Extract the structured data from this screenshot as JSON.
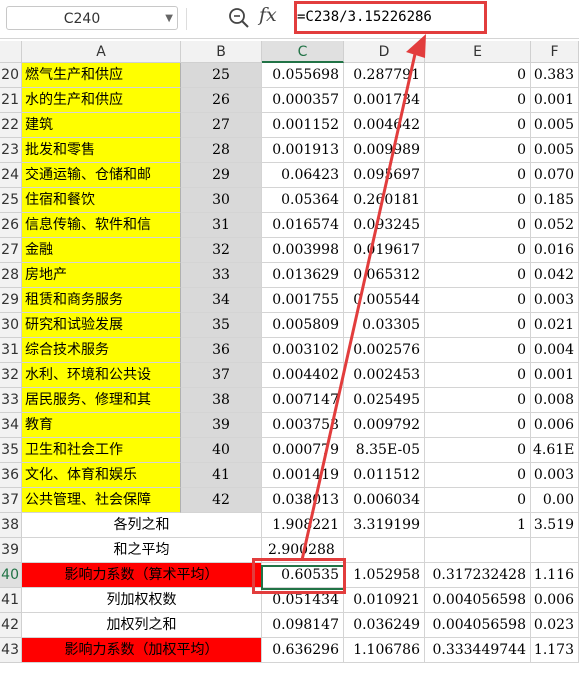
{
  "formula_bar": {
    "name_box": "C240",
    "fx_label": "fx",
    "formula": "=C238/3.15226286"
  },
  "columns": [
    "A",
    "B",
    "C",
    "D",
    "E",
    "F"
  ],
  "rows": [
    {
      "num": "20",
      "a": "燃气生产和供应",
      "b": "25",
      "c": "0.055698",
      "d": "0.287791",
      "e": "0",
      "f": "0.383"
    },
    {
      "num": "21",
      "a": "水的生产和供应",
      "b": "26",
      "c": "0.000357",
      "d": "0.001734",
      "e": "0",
      "f": "0.001"
    },
    {
      "num": "22",
      "a": "建筑",
      "b": "27",
      "c": "0.001152",
      "d": "0.004642",
      "e": "0",
      "f": "0.005"
    },
    {
      "num": "23",
      "a": "批发和零售",
      "b": "28",
      "c": "0.001913",
      "d": "0.009989",
      "e": "0",
      "f": "0.005"
    },
    {
      "num": "24",
      "a": "交通运输、仓储和邮",
      "b": "29",
      "c": "0.06423",
      "d": "0.095697",
      "e": "0",
      "f": "0.070"
    },
    {
      "num": "25",
      "a": "住宿和餐饮",
      "b": "30",
      "c": "0.05364",
      "d": "0.260181",
      "e": "0",
      "f": "0.185"
    },
    {
      "num": "26",
      "a": "信息传输、软件和信",
      "b": "31",
      "c": "0.016574",
      "d": "0.093245",
      "e": "0",
      "f": "0.052"
    },
    {
      "num": "27",
      "a": "金融",
      "b": "32",
      "c": "0.003998",
      "d": "0.019617",
      "e": "0",
      "f": "0.016"
    },
    {
      "num": "28",
      "a": "房地产",
      "b": "33",
      "c": "0.013629",
      "d": "0.065312",
      "e": "0",
      "f": "0.042"
    },
    {
      "num": "29",
      "a": "租赁和商务服务",
      "b": "34",
      "c": "0.001755",
      "d": "0.005544",
      "e": "0",
      "f": "0.003"
    },
    {
      "num": "30",
      "a": "研究和试验发展",
      "b": "35",
      "c": "0.005809",
      "d": "0.03305",
      "e": "0",
      "f": "0.021"
    },
    {
      "num": "31",
      "a": "综合技术服务",
      "b": "36",
      "c": "0.003102",
      "d": "0.002576",
      "e": "0",
      "f": "0.004"
    },
    {
      "num": "32",
      "a": "水利、环境和公共设",
      "b": "37",
      "c": "0.004402",
      "d": "0.002453",
      "e": "0",
      "f": "0.001"
    },
    {
      "num": "33",
      "a": "居民服务、修理和其",
      "b": "38",
      "c": "0.007147",
      "d": "0.025495",
      "e": "0",
      "f": "0.008"
    },
    {
      "num": "34",
      "a": "教育",
      "b": "39",
      "c": "0.003753",
      "d": "0.009792",
      "e": "0",
      "f": "0.006"
    },
    {
      "num": "35",
      "a": "卫生和社会工作",
      "b": "40",
      "c": "0.000779",
      "d": "8.35E-05",
      "e": "0",
      "f": "4.61E"
    },
    {
      "num": "36",
      "a": "文化、体育和娱乐",
      "b": "41",
      "c": "0.001419",
      "d": "0.011512",
      "e": "0",
      "f": "0.003"
    },
    {
      "num": "37",
      "a": "公共管理、社会保障",
      "b": "42",
      "c": "0.038013",
      "d": "0.006034",
      "e": "0",
      "f": "0.00"
    }
  ],
  "summary_rows": [
    {
      "num": "38",
      "label": "各列之和",
      "c": "1.908221",
      "d": "3.319199",
      "e": "1",
      "f": "3.519"
    },
    {
      "num": "39",
      "label": "和之平均",
      "c": "2.900288",
      "d": "",
      "e": "",
      "f": ""
    },
    {
      "num": "40",
      "label": "影响力系数（算术平均）",
      "c": "0.60535",
      "d": "1.052958",
      "e": "0.317232428",
      "f": "1.116",
      "red": true
    },
    {
      "num": "41",
      "label": "列加权权数",
      "c": "0.051434",
      "d": "0.010921",
      "e": "0.004056598",
      "f": "0.006"
    },
    {
      "num": "42",
      "label": "加权列之和",
      "c": "0.098147",
      "d": "0.036249",
      "e": "0.004056598",
      "f": "0.023"
    },
    {
      "num": "43",
      "label": "影响力系数（加权平均）",
      "c": "0.636296",
      "d": "1.106786",
      "e": "0.333449744",
      "f": "1.173",
      "red": true
    }
  ],
  "colors": {
    "highlight_yellow": "#ffff00",
    "label_red": "#ff0000",
    "callout_red": "#e23d3d",
    "select_green": "#217346"
  }
}
